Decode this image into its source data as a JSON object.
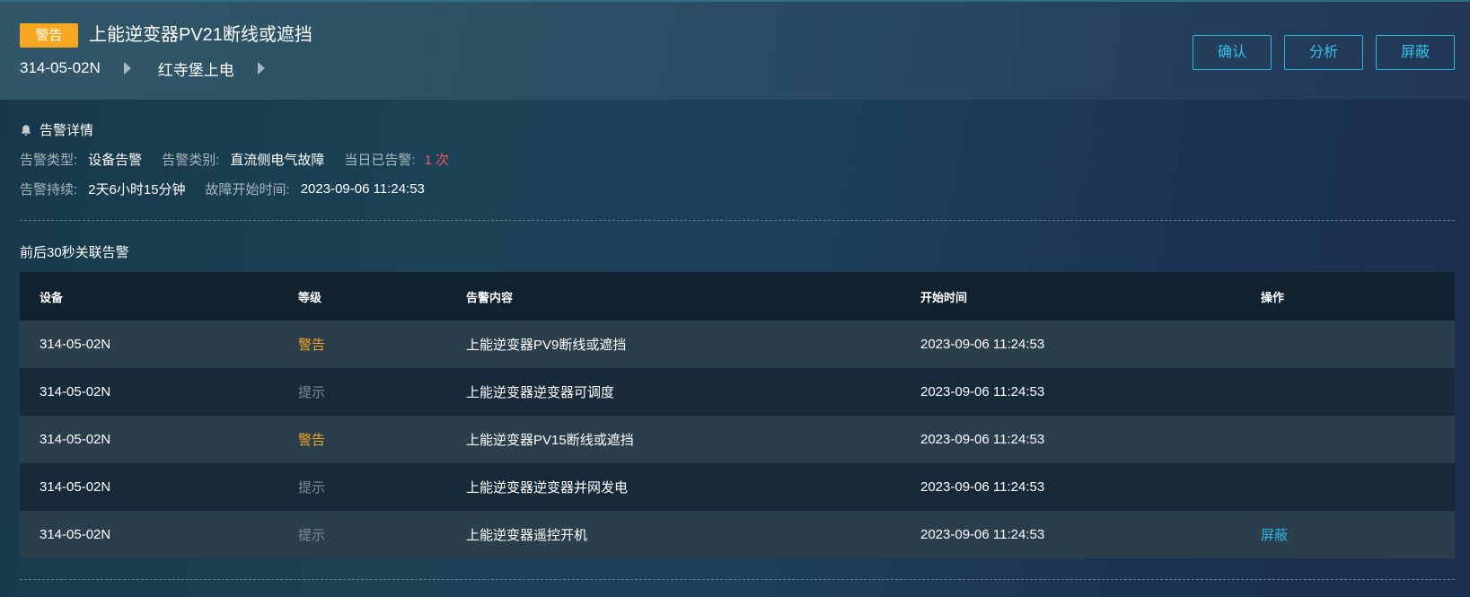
{
  "header": {
    "badge": "警告",
    "title": "上能逆变器PV21断线或遮挡",
    "breadcrumb": [
      "314-05-02N",
      "红寺堡上电"
    ],
    "actions": {
      "confirm": "确认",
      "analyze": "分析",
      "shield": "屏蔽"
    }
  },
  "details": {
    "title": "告警详情",
    "row1": {
      "type_label": "告警类型:",
      "type_value": "设备告警",
      "category_label": "告警类别:",
      "category_value": "直流侧电气故障",
      "today_label": "当日已告警:",
      "today_value": "1 次"
    },
    "row2": {
      "duration_label": "告警持续:",
      "duration_value": "2天6小时15分钟",
      "start_label": "故障开始时间:",
      "start_value": "2023-09-06 11:24:53"
    }
  },
  "related": {
    "title": "前后30秒关联告警",
    "columns": [
      "设备",
      "等级",
      "告警内容",
      "开始时间",
      "操作"
    ],
    "rows": [
      {
        "device": "314-05-02N",
        "level": "警告",
        "content": "上能逆变器PV9断线或遮挡",
        "time": "2023-09-06 11:24:53",
        "op": ""
      },
      {
        "device": "314-05-02N",
        "level": "提示",
        "content": "上能逆变器逆变器可调度",
        "time": "2023-09-06 11:24:53",
        "op": ""
      },
      {
        "device": "314-05-02N",
        "level": "警告",
        "content": "上能逆变器PV15断线或遮挡",
        "time": "2023-09-06 11:24:53",
        "op": ""
      },
      {
        "device": "314-05-02N",
        "level": "提示",
        "content": "上能逆变器逆变器并网发电",
        "time": "2023-09-06 11:24:53",
        "op": ""
      },
      {
        "device": "314-05-02N",
        "level": "提示",
        "content": "上能逆变器遥控开机",
        "time": "2023-09-06 11:24:53",
        "op": "屏蔽"
      }
    ]
  },
  "colors": {
    "warning": "#f5a623",
    "tip": "#7f8b93",
    "accent": "#2fb4e6",
    "count": "#f0585f"
  },
  "icons": {
    "details": "bell-icon",
    "breadcrumb_separator": "triangle-right-icon"
  }
}
